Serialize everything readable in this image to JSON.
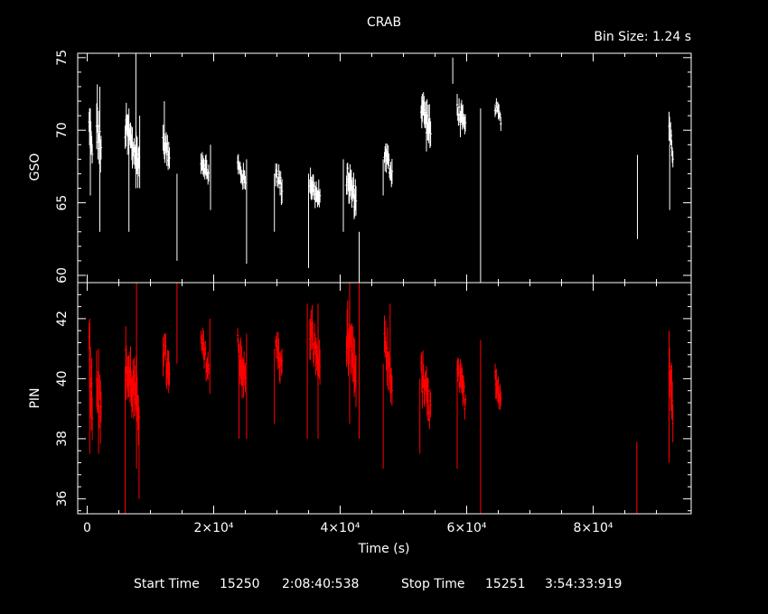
{
  "chart_data": {
    "type": "scatter",
    "title": "CRAB",
    "bin_size_label": "Bin Size: 1.24 s",
    "xlabel": "Time (s)",
    "xlim": [
      -1500,
      95500
    ],
    "x_ticks": [
      {
        "value": 0,
        "label": "0"
      },
      {
        "value": 20000,
        "label": "2×10⁴"
      },
      {
        "value": 40000,
        "label": "4×10⁴"
      },
      {
        "value": 60000,
        "label": "6×10⁴"
      },
      {
        "value": 80000,
        "label": "8×10⁴"
      }
    ],
    "footer": {
      "start_label": "Start Time",
      "start_day": "15250",
      "start_time": "2:08:40:538",
      "stop_label": "Stop Time",
      "stop_day": "15251",
      "stop_time": "3:54:33:919"
    },
    "panels": [
      {
        "name": "gso",
        "ylabel": "GSO",
        "ylim": [
          59.5,
          75.3
        ],
        "yticks": [
          60,
          65,
          70,
          75
        ],
        "color": "#ffffff",
        "segments": [
          {
            "x0": 300,
            "x1": 800,
            "lo": 67.5,
            "hi": 71
          },
          {
            "x0": 1500,
            "x1": 2200,
            "lo": 67,
            "hi": 72
          },
          {
            "x0": 6000,
            "x1": 8200,
            "lo": 67,
            "hi": 71
          },
          {
            "x0": 12000,
            "x1": 13000,
            "lo": 67.5,
            "hi": 70
          },
          {
            "x0": 18000,
            "x1": 19200,
            "lo": 66.5,
            "hi": 68.5
          },
          {
            "x0": 23800,
            "x1": 25000,
            "lo": 66,
            "hi": 68
          },
          {
            "x0": 29800,
            "x1": 30800,
            "lo": 65.5,
            "hi": 67.8
          },
          {
            "x0": 35200,
            "x1": 36800,
            "lo": 64.5,
            "hi": 67
          },
          {
            "x0": 41000,
            "x1": 42500,
            "lo": 64.5,
            "hi": 67.5
          },
          {
            "x0": 47000,
            "x1": 48200,
            "lo": 66.5,
            "hi": 69
          },
          {
            "x0": 52800,
            "x1": 54300,
            "lo": 69,
            "hi": 72.5
          },
          {
            "x0": 58500,
            "x1": 59800,
            "lo": 69.5,
            "hi": 72
          },
          {
            "x0": 64500,
            "x1": 65400,
            "lo": 70.5,
            "hi": 72
          },
          {
            "x0": 92000,
            "x1": 92600,
            "lo": 68,
            "hi": 71
          }
        ],
        "spikes": [
          {
            "x": 500,
            "lo": 65.5,
            "hi": 71.5
          },
          {
            "x": 2000,
            "lo": 63,
            "hi": 73
          },
          {
            "x": 6600,
            "lo": 63,
            "hi": 71.5
          },
          {
            "x": 7700,
            "lo": 66,
            "hi": 75.3
          },
          {
            "x": 8300,
            "lo": 66,
            "hi": 71
          },
          {
            "x": 12200,
            "lo": 68,
            "hi": 72
          },
          {
            "x": 14200,
            "lo": 61,
            "hi": 67
          },
          {
            "x": 19500,
            "lo": 64.5,
            "hi": 69
          },
          {
            "x": 25200,
            "lo": 60.8,
            "hi": 68
          },
          {
            "x": 29600,
            "lo": 63,
            "hi": 67
          },
          {
            "x": 35000,
            "lo": 60.5,
            "hi": 67
          },
          {
            "x": 40500,
            "lo": 63,
            "hi": 68
          },
          {
            "x": 43000,
            "lo": 59.5,
            "hi": 63
          },
          {
            "x": 46800,
            "lo": 65.5,
            "hi": 68
          },
          {
            "x": 57800,
            "lo": 73.2,
            "hi": 75
          },
          {
            "x": 62200,
            "lo": 59.5,
            "hi": 71.5
          },
          {
            "x": 87000,
            "lo": 62.5,
            "hi": 68.3
          },
          {
            "x": 92100,
            "lo": 64.5,
            "hi": 69
          }
        ]
      },
      {
        "name": "pin",
        "ylabel": "PIN",
        "ylim": [
          35.5,
          43.2
        ],
        "yticks": [
          36,
          38,
          40,
          42
        ],
        "color": "#ff0000",
        "segments": [
          {
            "x0": 300,
            "x1": 800,
            "lo": 38.5,
            "hi": 41.5
          },
          {
            "x0": 1500,
            "x1": 2200,
            "lo": 38,
            "hi": 41
          },
          {
            "x0": 6000,
            "x1": 8200,
            "lo": 38.5,
            "hi": 41
          },
          {
            "x0": 12000,
            "x1": 13000,
            "lo": 39.5,
            "hi": 41.5
          },
          {
            "x0": 18000,
            "x1": 19200,
            "lo": 40,
            "hi": 41.5
          },
          {
            "x0": 23800,
            "x1": 25000,
            "lo": 39.5,
            "hi": 41.5
          },
          {
            "x0": 29800,
            "x1": 30800,
            "lo": 40,
            "hi": 41.5
          },
          {
            "x0": 35200,
            "x1": 36800,
            "lo": 40,
            "hi": 42
          },
          {
            "x0": 41000,
            "x1": 42500,
            "lo": 39.5,
            "hi": 42
          },
          {
            "x0": 47000,
            "x1": 48200,
            "lo": 39.5,
            "hi": 41.5
          },
          {
            "x0": 52800,
            "x1": 54300,
            "lo": 38.5,
            "hi": 40.5
          },
          {
            "x0": 58500,
            "x1": 59800,
            "lo": 39,
            "hi": 40.5
          },
          {
            "x0": 64500,
            "x1": 65400,
            "lo": 39,
            "hi": 40.5
          },
          {
            "x0": 92000,
            "x1": 92600,
            "lo": 38.5,
            "hi": 41
          }
        ],
        "spikes": [
          {
            "x": 400,
            "lo": 37.5,
            "hi": 42
          },
          {
            "x": 1800,
            "lo": 37.5,
            "hi": 41
          },
          {
            "x": 6000,
            "lo": 35.5,
            "hi": 40
          },
          {
            "x": 7800,
            "lo": 37,
            "hi": 43.2
          },
          {
            "x": 8200,
            "lo": 36,
            "hi": 39
          },
          {
            "x": 14200,
            "lo": 40.5,
            "hi": 43.2
          },
          {
            "x": 19400,
            "lo": 39.5,
            "hi": 42
          },
          {
            "x": 24000,
            "lo": 38,
            "hi": 41
          },
          {
            "x": 25200,
            "lo": 38,
            "hi": 41.5
          },
          {
            "x": 29600,
            "lo": 38.5,
            "hi": 41
          },
          {
            "x": 34800,
            "lo": 38,
            "hi": 42.5
          },
          {
            "x": 36500,
            "lo": 38,
            "hi": 42.5
          },
          {
            "x": 41500,
            "lo": 38.5,
            "hi": 43.2
          },
          {
            "x": 43000,
            "lo": 38,
            "hi": 43.2
          },
          {
            "x": 46800,
            "lo": 37,
            "hi": 40.5
          },
          {
            "x": 47900,
            "lo": 40,
            "hi": 42.5
          },
          {
            "x": 52600,
            "lo": 37.5,
            "hi": 40
          },
          {
            "x": 58500,
            "lo": 37,
            "hi": 40
          },
          {
            "x": 62200,
            "lo": 35.5,
            "hi": 41.3
          },
          {
            "x": 86900,
            "lo": 35.5,
            "hi": 37.9
          },
          {
            "x": 92000,
            "lo": 37.2,
            "hi": 41.6
          }
        ]
      }
    ]
  }
}
